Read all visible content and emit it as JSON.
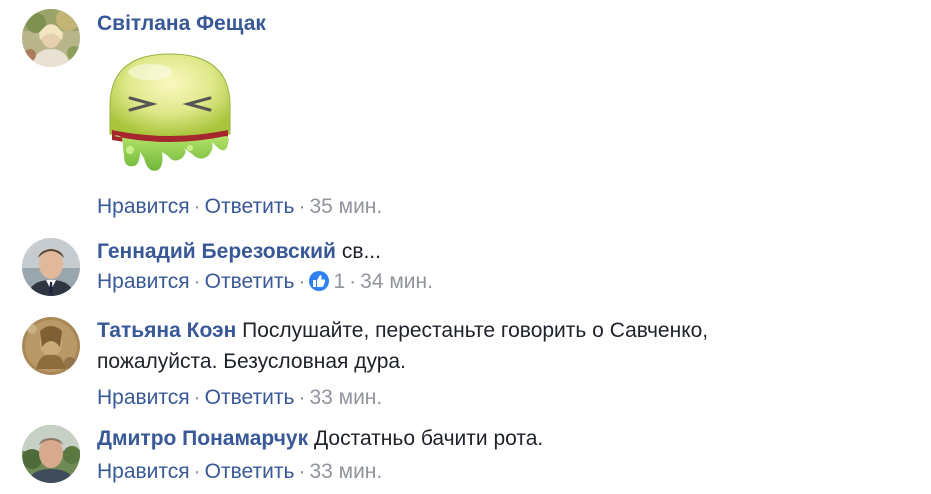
{
  "comments": [
    {
      "author": "Світлана Фещак",
      "text": "",
      "sticker": "vomit-face-sticker",
      "like_label": "Нравится",
      "reply_label": "Ответить",
      "time": "35 мин."
    },
    {
      "author": "Геннадий Березовский",
      "text": "св...",
      "like_label": "Нравится",
      "reply_label": "Ответить",
      "reaction_icon": "thumbs-up-icon",
      "reaction_count": "1",
      "time": "34 мин."
    },
    {
      "author": "Татьяна Коэн",
      "text_line1": "Послушайте, перестаньте говорить о Савченко,",
      "text_line2": "пожалуйста. Безусловная дура.",
      "like_label": "Нравится",
      "reply_label": "Ответить",
      "time": "33 мин."
    },
    {
      "author": "Дмитро Понамарчук",
      "text": "Достатньо бачити рота.",
      "like_label": "Нравится",
      "reply_label": "Ответить",
      "time": "33 мин."
    }
  ],
  "separator": "·",
  "colors": {
    "link": "#385898",
    "meta": "#90949c",
    "text": "#1d2129",
    "like_badge": "#2e80f2"
  }
}
